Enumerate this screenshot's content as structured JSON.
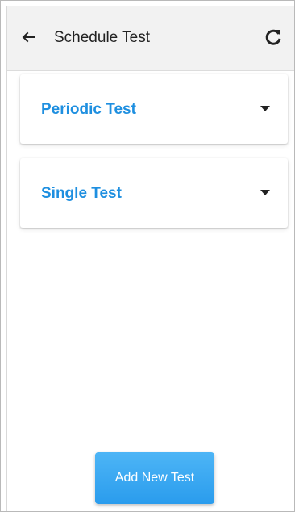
{
  "header": {
    "title": "Schedule Test",
    "back_icon": "arrow-left-icon",
    "refresh_icon": "refresh-icon"
  },
  "sections": [
    {
      "label": "Periodic Test",
      "icon": "caret-down-icon"
    },
    {
      "label": "Single Test",
      "icon": "caret-down-icon"
    }
  ],
  "actions": {
    "add_label": "Add New Test"
  },
  "colors": {
    "accent": "#1e8fe0",
    "button": "#2a9ced",
    "toolbar": "#f2f2f2"
  }
}
